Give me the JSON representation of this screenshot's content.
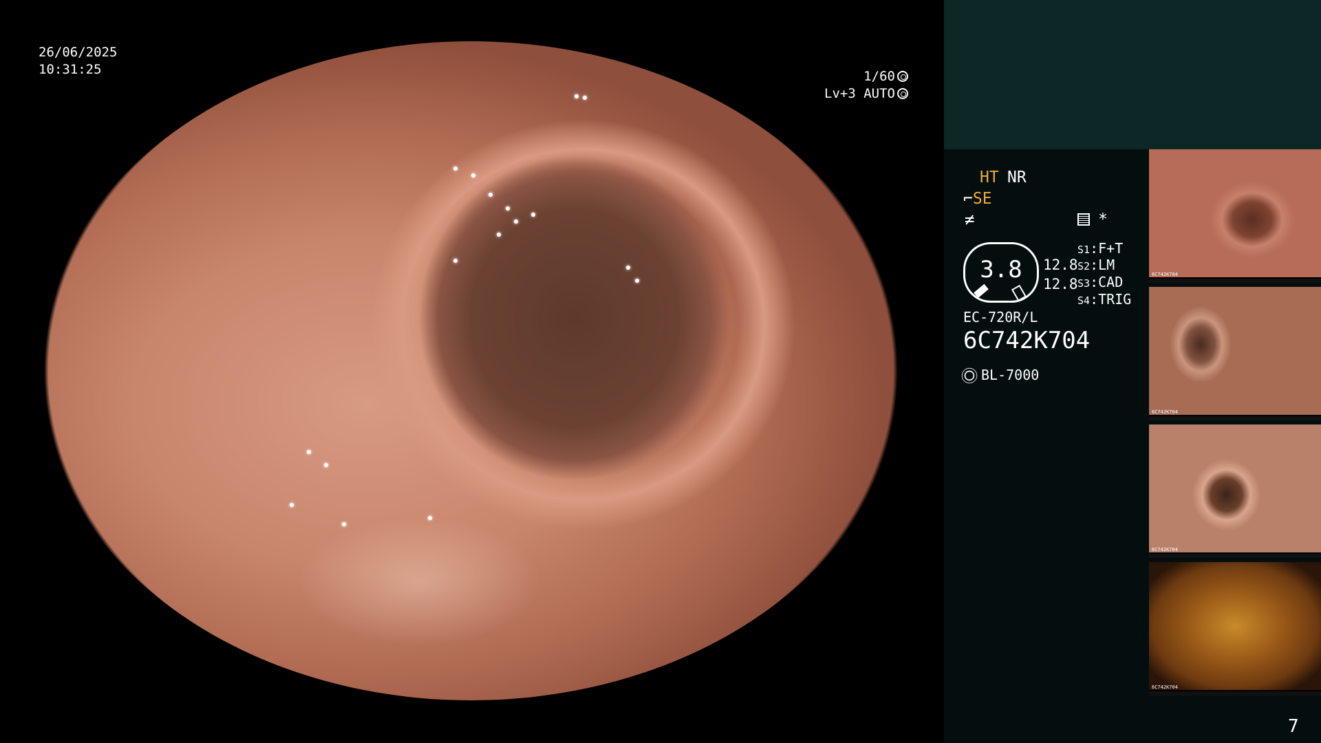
{
  "overlay": {
    "date": "26/06/2025",
    "time": "10:31:25",
    "shutter": "1/60",
    "level": "Lv+3",
    "iris_mode": "AUTO"
  },
  "settings": {
    "ht": "HT",
    "nr": "NR",
    "se": "SE",
    "mode_symbol": "≠",
    "asterisk": "*"
  },
  "gauge": {
    "value": "3.8",
    "ratio_top": "12.8",
    "ratio_bottom": "12.8"
  },
  "switches": [
    {
      "key": "S1",
      "value": "F+T"
    },
    {
      "key": "S2",
      "value": "LM"
    },
    {
      "key": "S3",
      "value": "CAD"
    },
    {
      "key": "S4",
      "value": "TRIG"
    }
  ],
  "scope": {
    "model": "EC-720R/L",
    "serial": "6C742K704",
    "light_source": "BL-7000"
  },
  "page_number": "7",
  "thumbnails": [
    {
      "label": "6C742K704"
    },
    {
      "label": "6C742K704"
    },
    {
      "label": "6C742K704"
    },
    {
      "label": "6C742K704"
    }
  ],
  "colors": {
    "side_panel_bg": "#040e0e",
    "side_panel_top": "#0d2727",
    "accent_orange": "#f3a93a"
  }
}
